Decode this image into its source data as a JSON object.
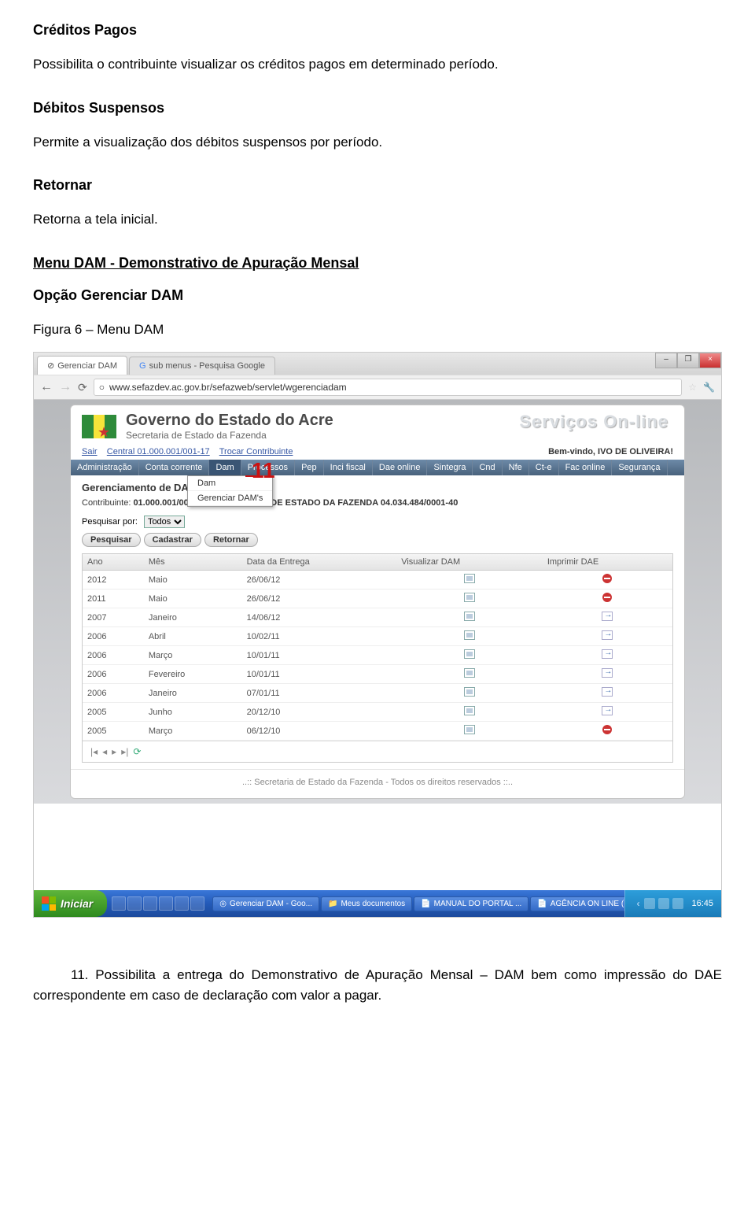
{
  "doc": {
    "h1": "Créditos Pagos",
    "p1": "Possibilita o contribuinte visualizar os créditos pagos em determinado período.",
    "h2": "Débitos Suspensos",
    "p2": "Permite a visualização dos débitos suspensos por período.",
    "h3": "Retornar",
    "p3": "Retorna a tela inicial.",
    "h4": "Menu DAM  - Demonstrativo de Apuração Mensal",
    "h5": "Opção Gerenciar DAM",
    "figlabel": "Figura 6 – Menu DAM",
    "callout": "11",
    "footnote": "11. Possibilita a entrega do Demonstrativo de Apuração Mensal – DAM bem como impressão do DAE correspondente em caso de declaração com valor  a pagar."
  },
  "browser": {
    "tab1": "Gerenciar DAM",
    "tab2": "sub menus - Pesquisa Google",
    "url": "www.sefazdev.ac.gov.br/sefazweb/servlet/wgerenciadam",
    "win_min": "–",
    "win_max": "❐",
    "win_close": "×",
    "back": "←",
    "forward": "→",
    "reload": "⟳"
  },
  "gov": {
    "title": "Governo do Estado do Acre",
    "subtitle": "Secretaria de Estado da Fazenda",
    "services": "Serviços On-line",
    "sair": "Sair",
    "central": "Central 01.000.001/001-17",
    "trocar": "Trocar Contribuinte",
    "welcome": "Bem-vindo, IVO DE OLIVEIRA!"
  },
  "menu": {
    "items": [
      "Administração",
      "Conta corrente",
      "Dam",
      "Processos",
      "Pep",
      "Inci fiscal",
      "Dae online",
      "Sintegra",
      "Cnd",
      "Nfe",
      "Ct-e",
      "Fac online",
      "Segurança"
    ],
    "sub": [
      "Dam",
      "Gerenciar DAM's"
    ]
  },
  "page": {
    "title": "Gerenciamento de DAM's",
    "contrib_label": "Contribuinte:",
    "contrib_value": "01.000.001/001-17 .  SECRETARIA DE ESTADO DA FAZENDA  04.034.484/0001-40",
    "search_label": "Pesquisar por:",
    "search_value": "Todos",
    "btn_search": "Pesquisar",
    "btn_add": "Cadastrar",
    "btn_back": "Retornar",
    "cols": [
      "Ano",
      "Mês",
      "Data da Entrega",
      "Visualizar DAM",
      "Imprimir DAE"
    ],
    "rows": [
      {
        "ano": "2012",
        "mes": "Maio",
        "data": "26/06/12",
        "dae": "no"
      },
      {
        "ano": "2011",
        "mes": "Maio",
        "data": "26/06/12",
        "dae": "no"
      },
      {
        "ano": "2007",
        "mes": "Janeiro",
        "data": "14/06/12",
        "dae": "yes"
      },
      {
        "ano": "2006",
        "mes": "Abril",
        "data": "10/02/11",
        "dae": "yes"
      },
      {
        "ano": "2006",
        "mes": "Março",
        "data": "10/01/11",
        "dae": "yes"
      },
      {
        "ano": "2006",
        "mes": "Fevereiro",
        "data": "10/01/11",
        "dae": "yes"
      },
      {
        "ano": "2006",
        "mes": "Janeiro",
        "data": "07/01/11",
        "dae": "yes"
      },
      {
        "ano": "2005",
        "mes": "Junho",
        "data": "20/12/10",
        "dae": "yes"
      },
      {
        "ano": "2005",
        "mes": "Março",
        "data": "06/12/10",
        "dae": "no"
      }
    ],
    "footer": "..:: Secretaria de Estado da Fazenda - Todos os direitos reservados ::.."
  },
  "taskbar": {
    "start": "Iniciar",
    "tasks": [
      "Gerenciar DAM - Goo...",
      "Meus documentos",
      "MANUAL DO PORTAL ...",
      "AGÊNCIA ON LINE (..."
    ],
    "clock": "16:45"
  }
}
